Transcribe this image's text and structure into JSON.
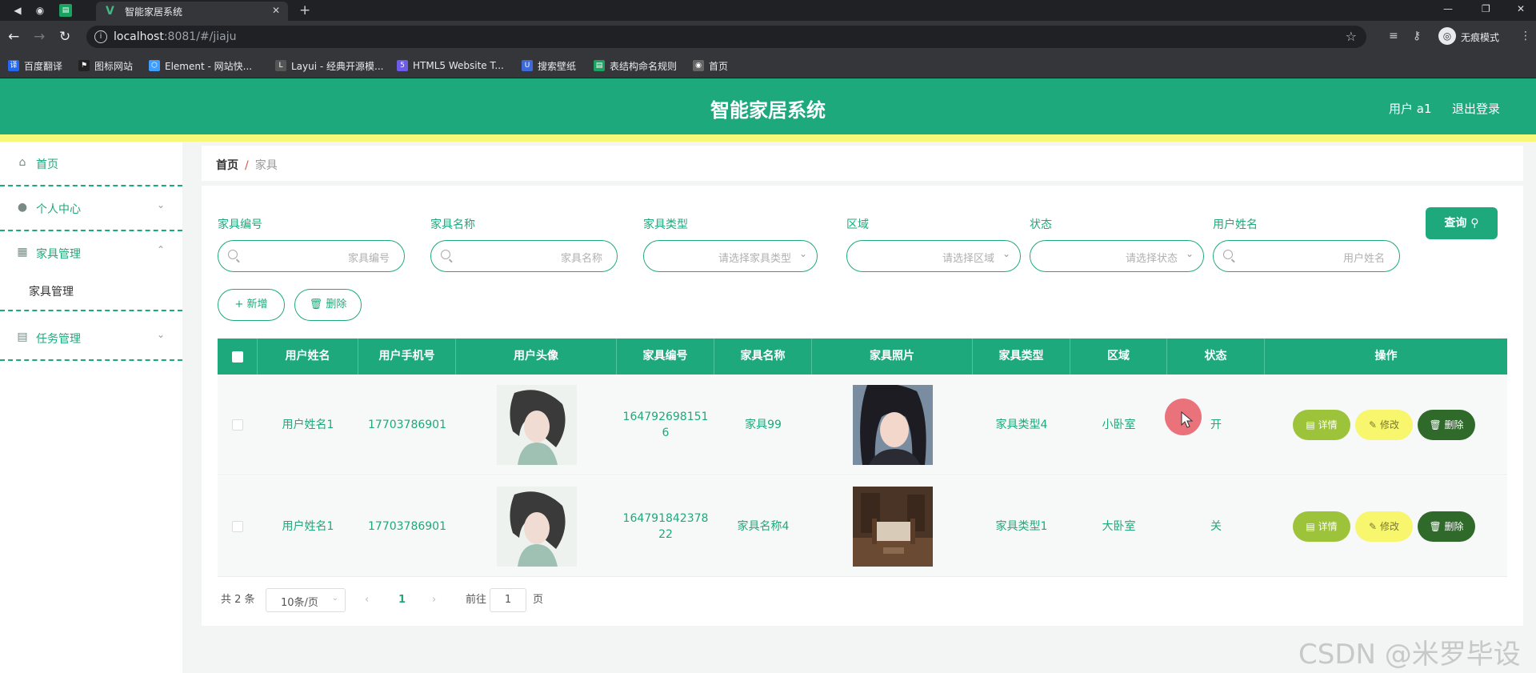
{
  "browser": {
    "tab_title": "智能家居系统",
    "url_host": "localhost",
    "url_path": ":8081/#/jiaju",
    "incognito_label": "无痕模式",
    "bookmarks": [
      {
        "label": "百度翻译",
        "color": "#2468f2"
      },
      {
        "label": "图标网站",
        "color": "#222222"
      },
      {
        "label": "Element - 网站快...",
        "color": "#409eff"
      },
      {
        "label": "Layui - 经典开源模...",
        "color": "#555555"
      },
      {
        "label": "HTML5 Website T...",
        "color": "#6c5ce7"
      },
      {
        "label": "搜索壁纸",
        "color": "#3d6ad6"
      },
      {
        "label": "表结构命名规则",
        "color": "#1aa260"
      },
      {
        "label": "首页",
        "color": "#666666"
      }
    ]
  },
  "header": {
    "title": "智能家居系统",
    "user": "用户 a1",
    "logout": "退出登录"
  },
  "sidebar": {
    "items": [
      {
        "label": "首页",
        "icon": "home-icon"
      },
      {
        "label": "个人中心",
        "icon": "user-icon"
      },
      {
        "label": "家具管理",
        "icon": "grid-icon"
      },
      {
        "label": "任务管理",
        "icon": "chart-icon"
      }
    ],
    "submenu_label": "家具管理"
  },
  "breadcrumb": {
    "home": "首页",
    "separator": "/",
    "current": "家具"
  },
  "filters": [
    {
      "label": "家具编号",
      "placeholder": "家具编号",
      "type": "text"
    },
    {
      "label": "家具名称",
      "placeholder": "家具名称",
      "type": "text"
    },
    {
      "label": "家具类型",
      "placeholder": "请选择家具类型",
      "type": "select"
    },
    {
      "label": "区域",
      "placeholder": "请选择区域",
      "type": "select"
    },
    {
      "label": "状态",
      "placeholder": "请选择状态",
      "type": "select"
    },
    {
      "label": "用户姓名",
      "placeholder": "用户姓名",
      "type": "text"
    }
  ],
  "buttons": {
    "query": "查询",
    "add": "+ 新增",
    "delete": "删除"
  },
  "table": {
    "columns": [
      "用户姓名",
      "用户手机号",
      "用户头像",
      "家具编号",
      "家具名称",
      "家具照片",
      "家具类型",
      "区域",
      "状态",
      "操作"
    ],
    "rows": [
      {
        "name": "用户姓名1",
        "phone": "17703786901",
        "code_line1": "164792698151",
        "code_line2": "6",
        "furniture": "家具99",
        "type": "家具类型4",
        "area": "小卧室",
        "status": "开"
      },
      {
        "name": "用户姓名1",
        "phone": "17703786901",
        "code_line1": "164791842378",
        "code_line2": "22",
        "furniture": "家具名称4",
        "type": "家具类型1",
        "area": "大卧室",
        "status": "关"
      }
    ],
    "actions": {
      "detail": "详情",
      "edit": "修改",
      "delete": "删除"
    }
  },
  "pagination": {
    "total": "共 2 条",
    "page_size": "10条/页",
    "current_page": "1",
    "goto": "前往",
    "goto_value": "1",
    "page_suffix": "页"
  },
  "watermark": "CSDN @米罗毕设",
  "colors": {
    "primary": "#1ea97c",
    "accent_yellow": "#f7f77a",
    "detail": "#9dc33b",
    "edit": "#f7f66d",
    "delete": "#2f6a2b"
  }
}
